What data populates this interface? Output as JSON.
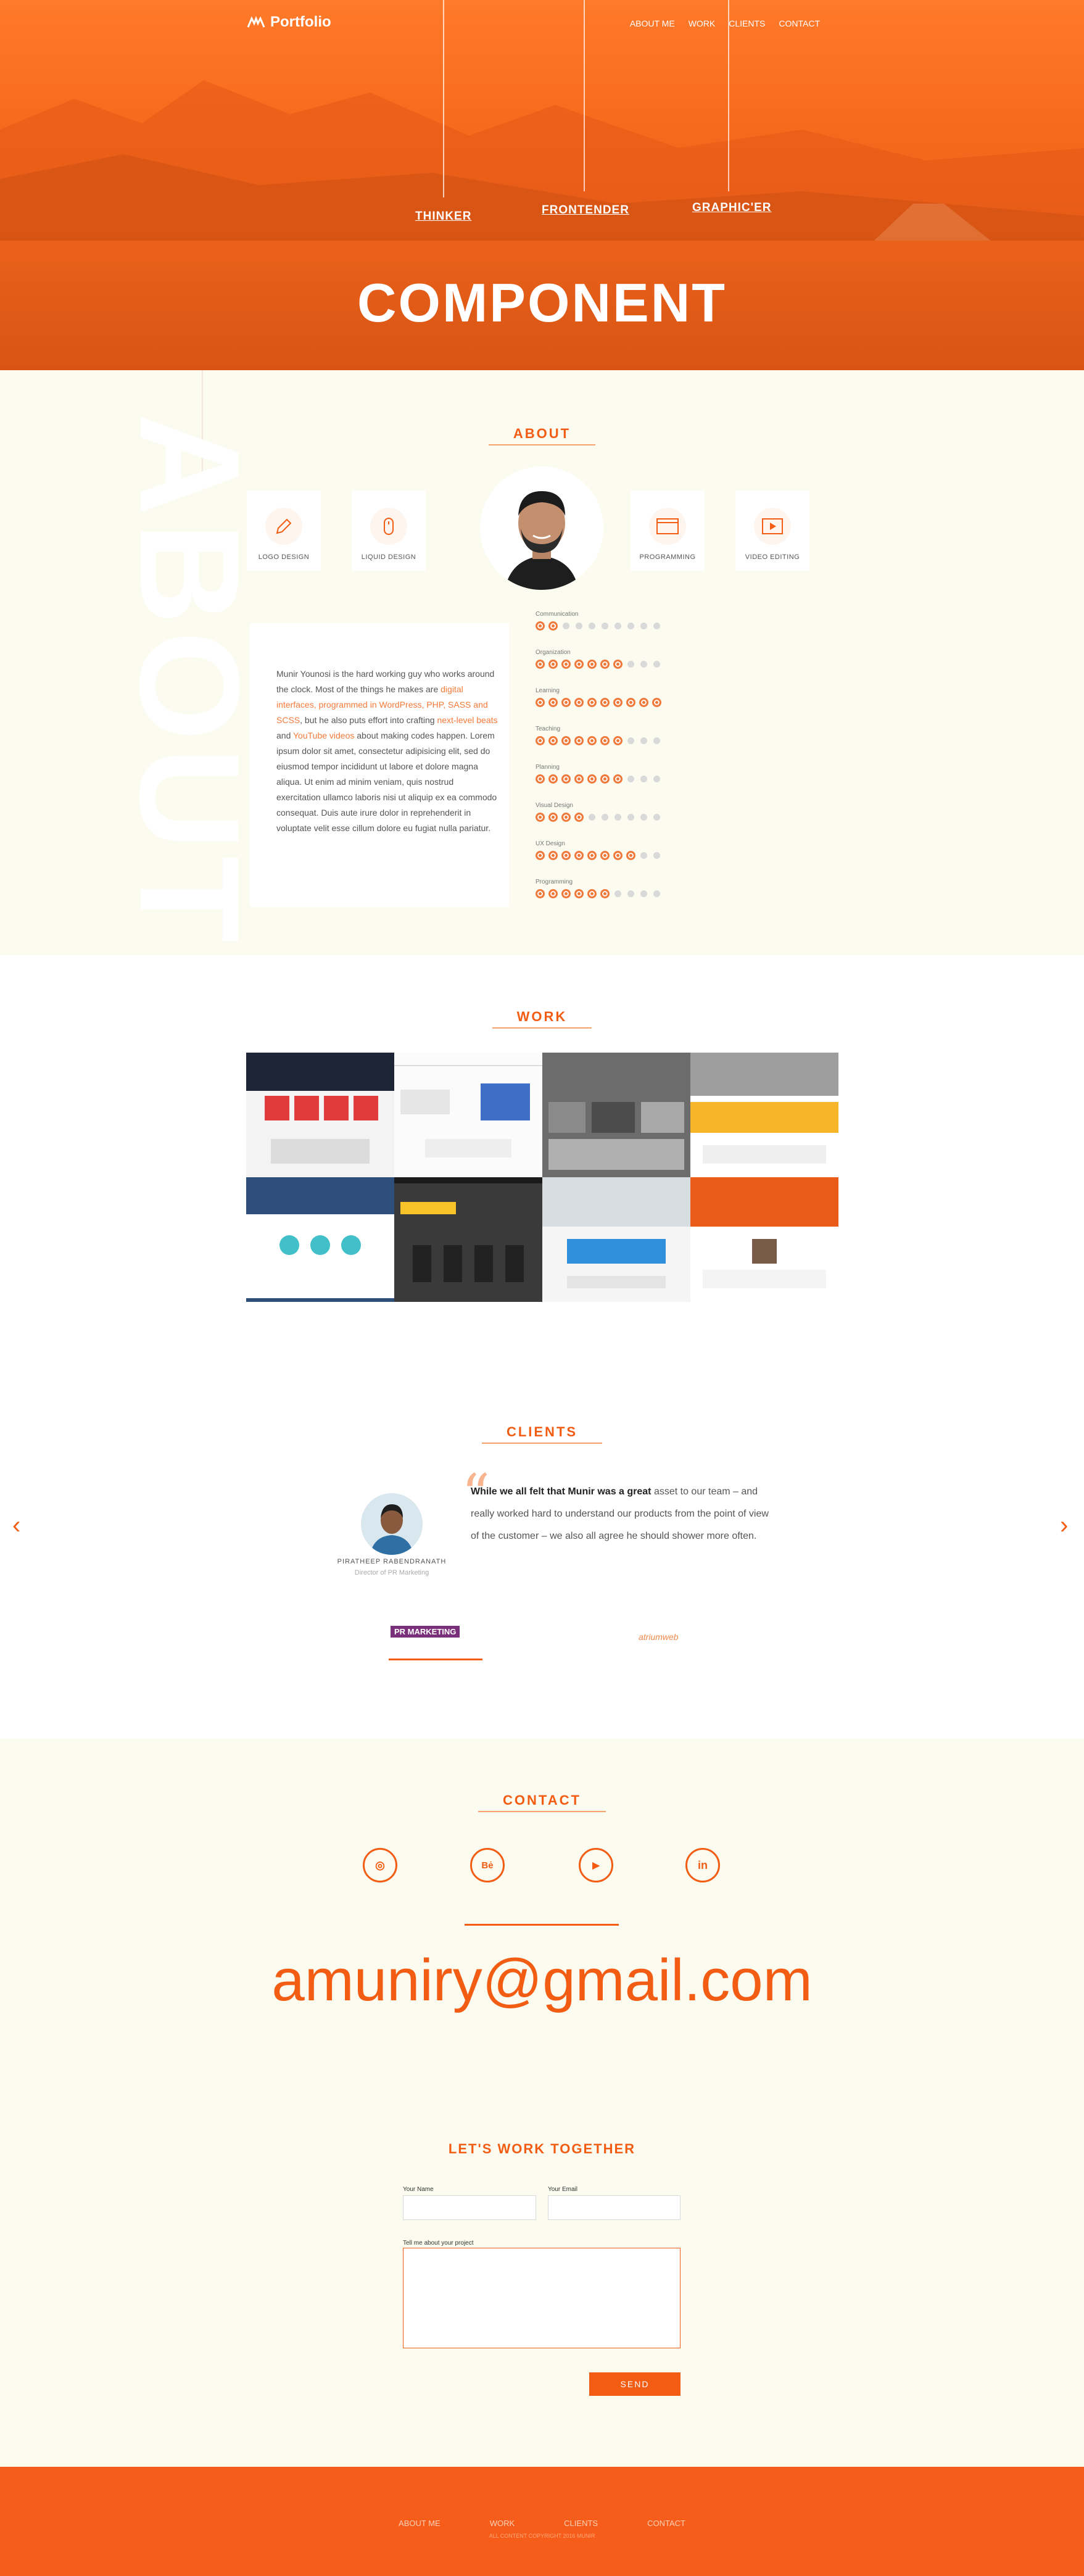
{
  "brand": {
    "logo_text": "Portfolio",
    "accent": "#f25c13"
  },
  "nav": {
    "items": [
      "ABOUT ME",
      "WORK",
      "CLIENTS",
      "CONTACT"
    ]
  },
  "hero": {
    "tags": [
      "THINKER",
      "FRONTENDER",
      "GRAPHIC'ER"
    ],
    "title": "COMPONENT"
  },
  "about": {
    "heading": "ABOUT",
    "watermark": "ABOUT",
    "cards": [
      {
        "label": "LOGO DESIGN",
        "icon": "pencil-icon"
      },
      {
        "label": "LIQUID DESIGN",
        "icon": "mouse-icon"
      },
      {
        "label": "PROGRAMMING",
        "icon": "browser-icon"
      },
      {
        "label": "VIDEO EDITING",
        "icon": "play-icon"
      }
    ],
    "bio": {
      "p1": "Munir Younosi is the hard working guy who works around the clock. Most of the things he makes are ",
      "l1": "digital interfaces, programmed in WordPress, PHP, SASS and SCSS",
      "p2": ", but he also puts effort into crafting ",
      "l2": "next-level beats",
      "p3": " and ",
      "l3": "YouTube videos",
      "p4": " about making codes happen. Lorem ipsum dolor sit amet, consectetur adipisicing elit, sed do eiusmod tempor incididunt ut labore et dolore magna aliqua. Ut enim ad minim veniam, quis nostrud exercitation ullamco laboris nisi ut aliquip ex ea commodo consequat. Duis aute irure dolor in reprehenderit in voluptate velit esse cillum dolore eu fugiat nulla pariatur."
    },
    "skills": [
      {
        "name": "Communication",
        "level": 2
      },
      {
        "name": "Organization",
        "level": 7
      },
      {
        "name": "Learning",
        "level": 10
      },
      {
        "name": "Teaching",
        "level": 7
      },
      {
        "name": "Planning",
        "level": 7
      },
      {
        "name": "Visual Design",
        "level": 4
      },
      {
        "name": "UX Design",
        "level": 8
      },
      {
        "name": "Programming",
        "level": 6
      }
    ],
    "skills_max": 10
  },
  "work": {
    "heading": "WORK"
  },
  "clients": {
    "heading": "CLIENTS",
    "quote_bold": "While we all felt that Munir was a great",
    "quote_rest": " asset to our team – and really worked hard to understand our products from the point of view of the customer – we also all agree he should shower more often.",
    "name": "PIRATHEEP RABENDRANATH",
    "role": "Director of PR Marketing",
    "logo1": "PR MARKETING",
    "logo2": "atriumweb"
  },
  "contact": {
    "heading": "CONTACT",
    "email": "amuniry@gmail.com",
    "socials": [
      {
        "icon": "dribbble-icon",
        "glyph": "◎"
      },
      {
        "icon": "behance-icon",
        "glyph": "Bė"
      },
      {
        "icon": "youtube-icon",
        "glyph": "▶"
      },
      {
        "icon": "linkedin-icon",
        "glyph": "in"
      }
    ]
  },
  "form": {
    "heading": "LET'S WORK TOGETHER",
    "name_label": "Your Name",
    "email_label": "Your Email",
    "message_label": "Tell me about your project",
    "send_label": "SEND"
  },
  "footer": {
    "items": [
      "ABOUT ME",
      "WORK",
      "CLIENTS",
      "CONTACT"
    ],
    "copy": "ALL CONTENT COPYRIGHT 2016 MUNIR"
  }
}
